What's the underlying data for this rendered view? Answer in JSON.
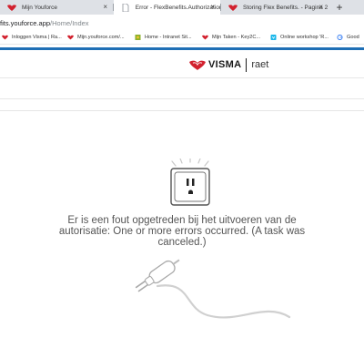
{
  "browser": {
    "tabs": [
      {
        "title": "Mijn Youforce",
        "active": false
      },
      {
        "title": "Error - FlexBenefits.Authorization",
        "active": true
      },
      {
        "title": "Storing Flex Benefits. - Pagina 2",
        "active": false
      }
    ],
    "tab_close": "×",
    "new_tab": "+",
    "address": {
      "host": "fits.youforce.app",
      "path": "/Home/Index"
    },
    "bookmarks": [
      {
        "label": "Inloggen Visma | Ra...",
        "icon": "visma-icon"
      },
      {
        "label": "Mijn.youforce.com/...",
        "icon": "visma-icon"
      },
      {
        "label": "Home - Intranet Sit...",
        "icon": "sharepoint-icon"
      },
      {
        "label": "Mijn Taken - Key2C...",
        "icon": "visma-icon"
      },
      {
        "label": "Online workshop 'R...",
        "icon": "vimeo-icon"
      },
      {
        "label": "Good",
        "icon": "google-icon"
      }
    ]
  },
  "brand": {
    "wordmark": "VISMA",
    "suffix": "raet",
    "color": "#d2212e",
    "accent": "#1f6fb5"
  },
  "error": {
    "message": "Er is een fout opgetreden bij het uitvoeren van de autorisatie: One or more errors occurred. (A task was canceled.)"
  },
  "illustrations": {
    "outlet": "power-outlet-icon",
    "plug": "unplugged-plug-icon"
  }
}
